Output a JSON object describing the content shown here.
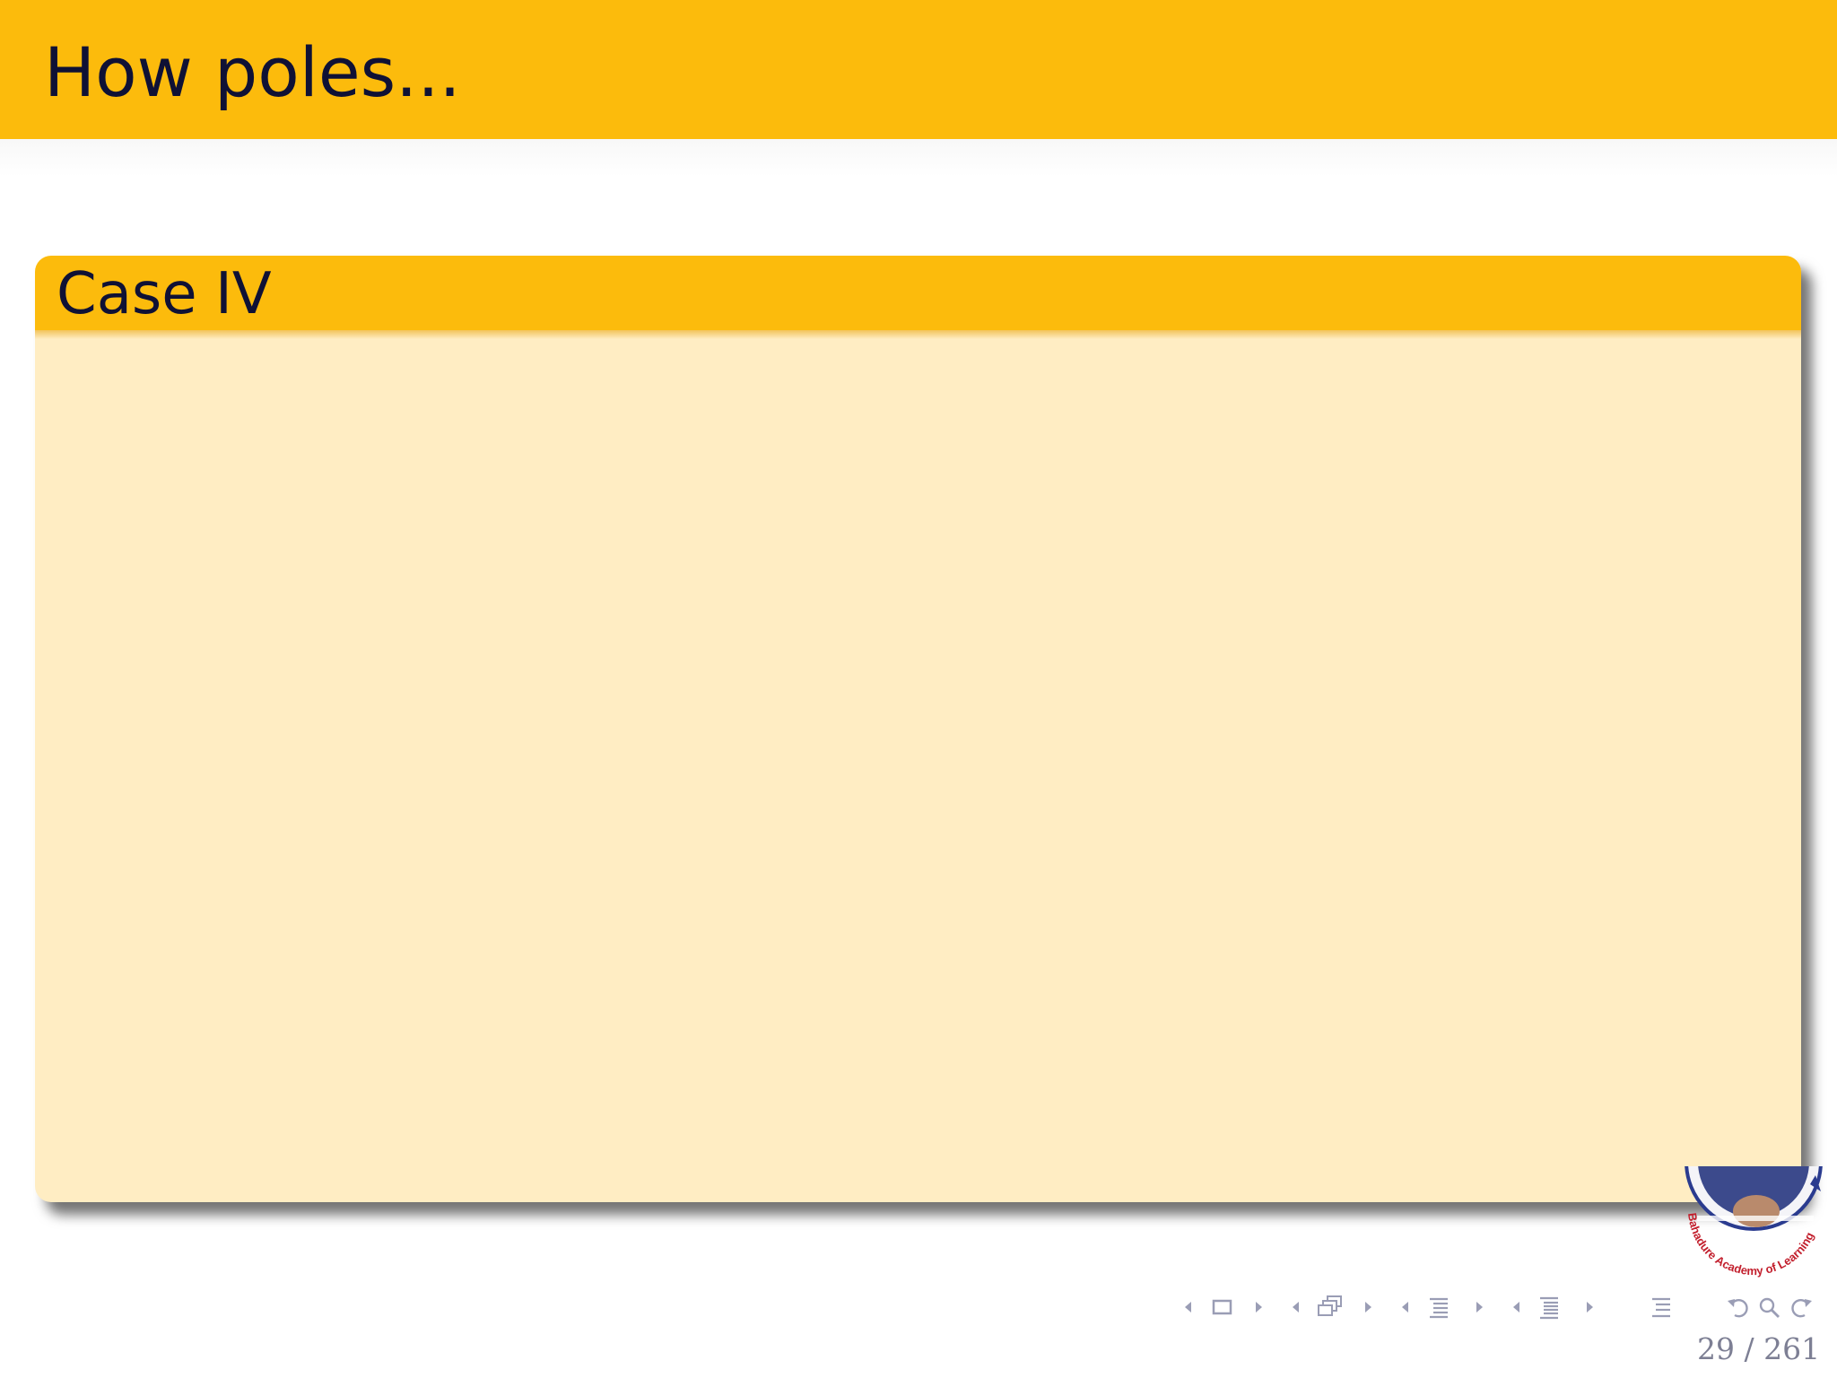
{
  "slide": {
    "title": "How poles...",
    "block": {
      "title": "Case IV"
    },
    "logo": {
      "text": "Bahadure Academy of Learning"
    },
    "navigation": {
      "icons": [
        "arrow-left-icon",
        "frame-icon",
        "arrow-right-icon",
        "arrow-left-icon",
        "subsection-icon",
        "arrow-right-icon",
        "arrow-left-icon",
        "section-icon",
        "arrow-right-icon",
        "arrow-left-icon",
        "document-icon",
        "arrow-right-icon",
        "outline-icon",
        "undo-icon",
        "search-icon",
        "redo-icon"
      ]
    },
    "page": {
      "current": "29",
      "separator": "/",
      "total": "261"
    }
  },
  "colors": {
    "accent": "#fcbb0c",
    "block_body": "#ffedc3",
    "title_text": "#0f1135",
    "nav_icons": "#9a9db5"
  }
}
